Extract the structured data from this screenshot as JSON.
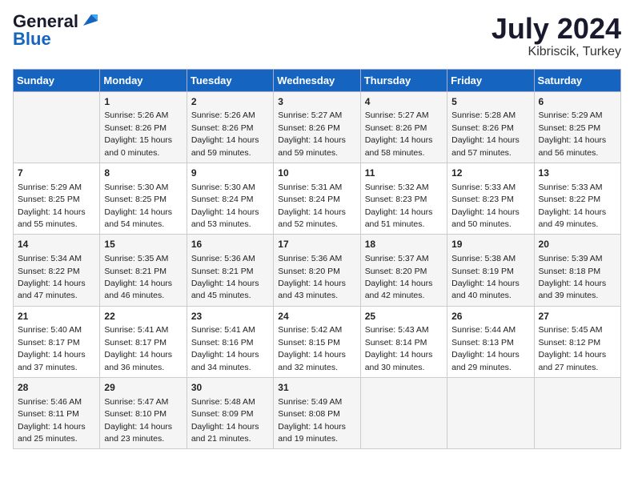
{
  "logo": {
    "general": "General",
    "blue": "Blue"
  },
  "title": "July 2024",
  "subtitle": "Kibriscik, Turkey",
  "days_header": [
    "Sunday",
    "Monday",
    "Tuesday",
    "Wednesday",
    "Thursday",
    "Friday",
    "Saturday"
  ],
  "weeks": [
    [
      {
        "day": "",
        "info": ""
      },
      {
        "day": "1",
        "info": "Sunrise: 5:26 AM\nSunset: 8:26 PM\nDaylight: 15 hours\nand 0 minutes."
      },
      {
        "day": "2",
        "info": "Sunrise: 5:26 AM\nSunset: 8:26 PM\nDaylight: 14 hours\nand 59 minutes."
      },
      {
        "day": "3",
        "info": "Sunrise: 5:27 AM\nSunset: 8:26 PM\nDaylight: 14 hours\nand 59 minutes."
      },
      {
        "day": "4",
        "info": "Sunrise: 5:27 AM\nSunset: 8:26 PM\nDaylight: 14 hours\nand 58 minutes."
      },
      {
        "day": "5",
        "info": "Sunrise: 5:28 AM\nSunset: 8:26 PM\nDaylight: 14 hours\nand 57 minutes."
      },
      {
        "day": "6",
        "info": "Sunrise: 5:29 AM\nSunset: 8:25 PM\nDaylight: 14 hours\nand 56 minutes."
      }
    ],
    [
      {
        "day": "7",
        "info": "Sunrise: 5:29 AM\nSunset: 8:25 PM\nDaylight: 14 hours\nand 55 minutes."
      },
      {
        "day": "8",
        "info": "Sunrise: 5:30 AM\nSunset: 8:25 PM\nDaylight: 14 hours\nand 54 minutes."
      },
      {
        "day": "9",
        "info": "Sunrise: 5:30 AM\nSunset: 8:24 PM\nDaylight: 14 hours\nand 53 minutes."
      },
      {
        "day": "10",
        "info": "Sunrise: 5:31 AM\nSunset: 8:24 PM\nDaylight: 14 hours\nand 52 minutes."
      },
      {
        "day": "11",
        "info": "Sunrise: 5:32 AM\nSunset: 8:23 PM\nDaylight: 14 hours\nand 51 minutes."
      },
      {
        "day": "12",
        "info": "Sunrise: 5:33 AM\nSunset: 8:23 PM\nDaylight: 14 hours\nand 50 minutes."
      },
      {
        "day": "13",
        "info": "Sunrise: 5:33 AM\nSunset: 8:22 PM\nDaylight: 14 hours\nand 49 minutes."
      }
    ],
    [
      {
        "day": "14",
        "info": "Sunrise: 5:34 AM\nSunset: 8:22 PM\nDaylight: 14 hours\nand 47 minutes."
      },
      {
        "day": "15",
        "info": "Sunrise: 5:35 AM\nSunset: 8:21 PM\nDaylight: 14 hours\nand 46 minutes."
      },
      {
        "day": "16",
        "info": "Sunrise: 5:36 AM\nSunset: 8:21 PM\nDaylight: 14 hours\nand 45 minutes."
      },
      {
        "day": "17",
        "info": "Sunrise: 5:36 AM\nSunset: 8:20 PM\nDaylight: 14 hours\nand 43 minutes."
      },
      {
        "day": "18",
        "info": "Sunrise: 5:37 AM\nSunset: 8:20 PM\nDaylight: 14 hours\nand 42 minutes."
      },
      {
        "day": "19",
        "info": "Sunrise: 5:38 AM\nSunset: 8:19 PM\nDaylight: 14 hours\nand 40 minutes."
      },
      {
        "day": "20",
        "info": "Sunrise: 5:39 AM\nSunset: 8:18 PM\nDaylight: 14 hours\nand 39 minutes."
      }
    ],
    [
      {
        "day": "21",
        "info": "Sunrise: 5:40 AM\nSunset: 8:17 PM\nDaylight: 14 hours\nand 37 minutes."
      },
      {
        "day": "22",
        "info": "Sunrise: 5:41 AM\nSunset: 8:17 PM\nDaylight: 14 hours\nand 36 minutes."
      },
      {
        "day": "23",
        "info": "Sunrise: 5:41 AM\nSunset: 8:16 PM\nDaylight: 14 hours\nand 34 minutes."
      },
      {
        "day": "24",
        "info": "Sunrise: 5:42 AM\nSunset: 8:15 PM\nDaylight: 14 hours\nand 32 minutes."
      },
      {
        "day": "25",
        "info": "Sunrise: 5:43 AM\nSunset: 8:14 PM\nDaylight: 14 hours\nand 30 minutes."
      },
      {
        "day": "26",
        "info": "Sunrise: 5:44 AM\nSunset: 8:13 PM\nDaylight: 14 hours\nand 29 minutes."
      },
      {
        "day": "27",
        "info": "Sunrise: 5:45 AM\nSunset: 8:12 PM\nDaylight: 14 hours\nand 27 minutes."
      }
    ],
    [
      {
        "day": "28",
        "info": "Sunrise: 5:46 AM\nSunset: 8:11 PM\nDaylight: 14 hours\nand 25 minutes."
      },
      {
        "day": "29",
        "info": "Sunrise: 5:47 AM\nSunset: 8:10 PM\nDaylight: 14 hours\nand 23 minutes."
      },
      {
        "day": "30",
        "info": "Sunrise: 5:48 AM\nSunset: 8:09 PM\nDaylight: 14 hours\nand 21 minutes."
      },
      {
        "day": "31",
        "info": "Sunrise: 5:49 AM\nSunset: 8:08 PM\nDaylight: 14 hours\nand 19 minutes."
      },
      {
        "day": "",
        "info": ""
      },
      {
        "day": "",
        "info": ""
      },
      {
        "day": "",
        "info": ""
      }
    ]
  ]
}
